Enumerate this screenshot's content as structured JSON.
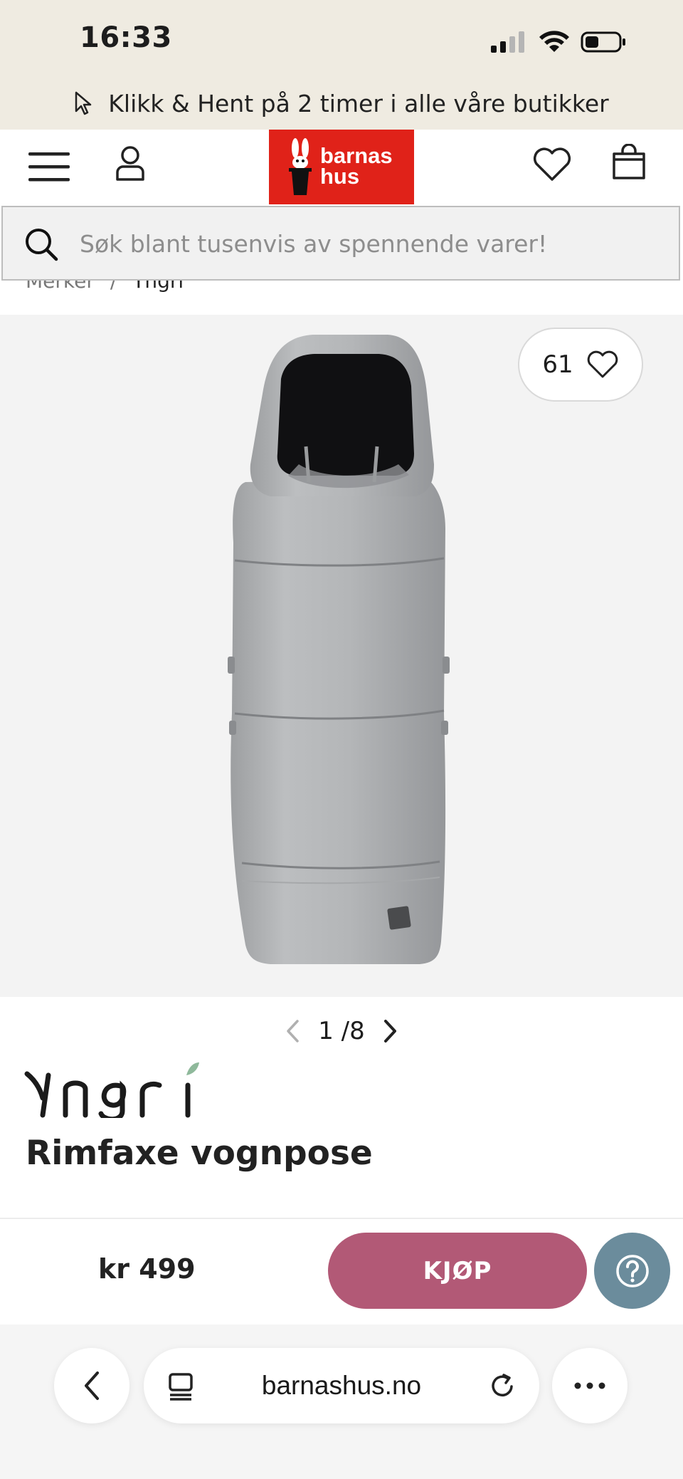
{
  "status_bar": {
    "time": "16:33"
  },
  "promo": {
    "text": "Klikk & Hent på 2 timer i alle våre butikker",
    "icon": "cursor-icon"
  },
  "header": {
    "logo_line1": "barnas",
    "logo_line2": "hus",
    "brand_color": "#e02219"
  },
  "search": {
    "placeholder": "Søk blant tusenvis av spennende varer!"
  },
  "breadcrumb": {
    "items": [
      "Merker",
      "Yngri"
    ],
    "separator": "/"
  },
  "gallery": {
    "favorite_count": "61",
    "current": "1",
    "separator": "/",
    "total": "8"
  },
  "product": {
    "brand": "Yngri",
    "title": "Rimfaxe vognpose",
    "price": "kr 499"
  },
  "buy_button": {
    "label": "KJØP",
    "color": "#b25976"
  },
  "help_button": {
    "color": "#6b8c9c"
  },
  "browser": {
    "url": "barnashus.no"
  }
}
